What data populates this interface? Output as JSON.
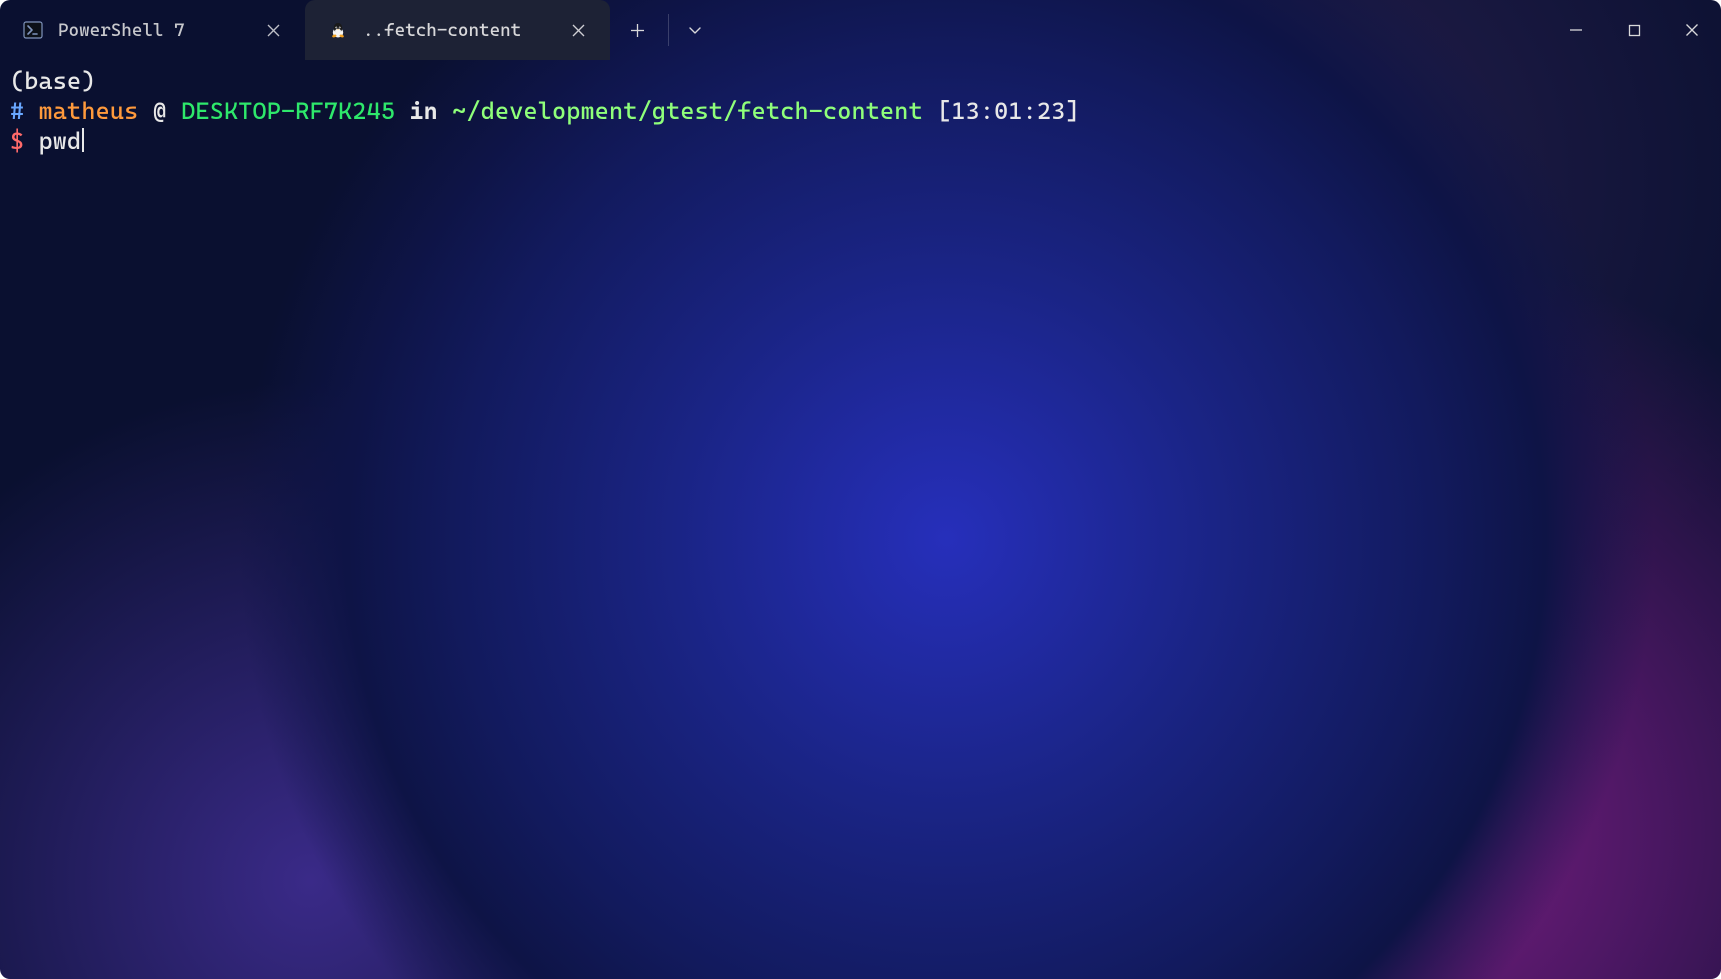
{
  "tabs": [
    {
      "icon": "powershell-icon",
      "label": "PowerShell 7",
      "active": false
    },
    {
      "icon": "linux-icon",
      "label": "..fetch-content",
      "active": true
    }
  ],
  "prompt": {
    "env": "(base)",
    "hash": "#",
    "user": "matheus",
    "at": "@",
    "host": "DESKTOP-RF7K245",
    "in": "in",
    "path": "~/development/gtest/fetch-content",
    "time": "[13:01:23]",
    "dollar": "$",
    "command": "pwd"
  },
  "colors": {
    "hash": "#69a7ff",
    "user": "#ff9a3c",
    "host": "#2ee86b",
    "path": "#8fff7a",
    "dollar": "#ff6a6a",
    "text": "#e8e8e8"
  }
}
